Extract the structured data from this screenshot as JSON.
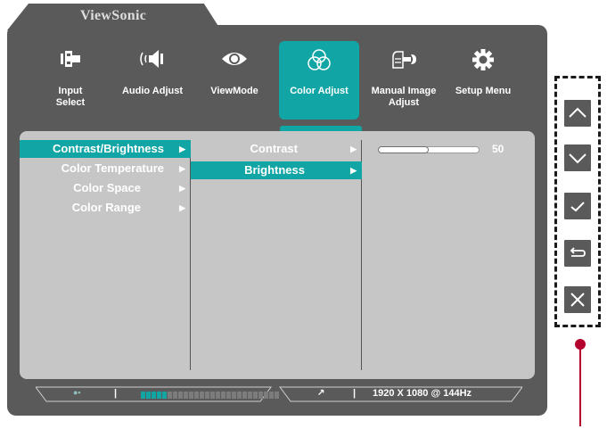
{
  "brand": "ViewSonic",
  "colors": {
    "frame": "#5a5a5a",
    "accent": "#12a5a5",
    "panel": "#c6c6c6",
    "pointer": "#b3002d"
  },
  "main_menu": [
    {
      "label": "Input\nSelect",
      "icon": "input-select-icon"
    },
    {
      "label": "Audio Adjust",
      "icon": "speaker-icon"
    },
    {
      "label": "ViewMode",
      "icon": "eye-icon"
    },
    {
      "label": "Color Adjust",
      "icon": "color-circles-icon",
      "active": true
    },
    {
      "label": "Manual Image\nAdjust",
      "icon": "wrench-hand-icon"
    },
    {
      "label": "Setup Menu",
      "icon": "gear-icon"
    }
  ],
  "submenu": [
    {
      "label": "Contrast/Brightness",
      "selected": true
    },
    {
      "label": "Color Temperature"
    },
    {
      "label": "Color Space"
    },
    {
      "label": "Color Range"
    }
  ],
  "third_menu": [
    {
      "label": "Contrast"
    },
    {
      "label": "Brightness",
      "selected": true
    }
  ],
  "brightness": {
    "value": "50",
    "fraction": 0.5
  },
  "status_bar": {
    "resolution": "1920 X 1080 @ 144Hz",
    "separator": "|",
    "level_segments": 26,
    "level_on": 5
  },
  "keys": [
    "up-icon",
    "down-icon",
    "check-icon",
    "return-icon",
    "close-icon"
  ]
}
